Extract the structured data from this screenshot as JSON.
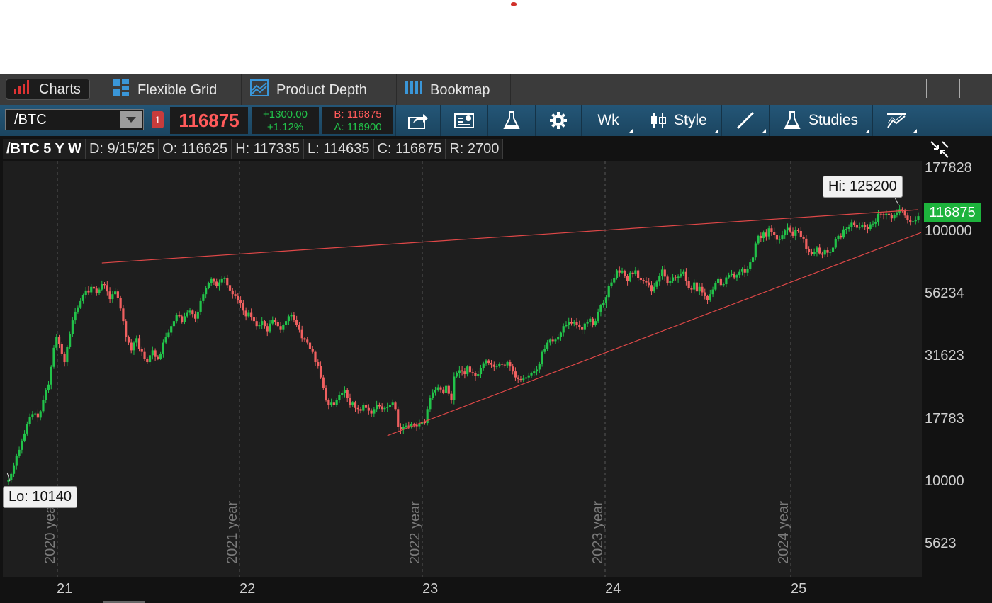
{
  "tabs": [
    {
      "label": "Charts",
      "icon": "bar-chart-icon",
      "active": true
    },
    {
      "label": "Flexible Grid",
      "icon": "grid-icon"
    },
    {
      "label": "Product Depth",
      "icon": "depth-icon"
    },
    {
      "label": "Bookmap",
      "icon": "bookmap-icon"
    }
  ],
  "toolbar": {
    "symbol": "/BTC",
    "badge": "1",
    "last": "116875",
    "change": "+1300.00",
    "change_pct": "+1.12%",
    "bid": "B: 116875",
    "ask": "A: 116900",
    "aggregation": "Wk",
    "style_label": "Style",
    "studies_label": "Studies"
  },
  "infobar": {
    "symbol": "/BTC 5 Y W",
    "date": "D: 9/15/25",
    "open": "O: 116625",
    "high": "H: 117335",
    "low": "L: 114635",
    "close": "C: 116875",
    "range": "R: 2700"
  },
  "colors": {
    "up": "#22c34a",
    "down": "#f06060",
    "trend": "#e04848"
  },
  "chart_data": {
    "type": "candlestick",
    "scale": "log",
    "ylim": [
      4000,
      250000
    ],
    "yticks": [
      "177828",
      "100000",
      "56234",
      "31623",
      "17783",
      "10000",
      "5623"
    ],
    "xticks": [
      "21",
      "22",
      "23",
      "24",
      "25"
    ],
    "year_labels": [
      "2020 year",
      "2021 year",
      "2022 year",
      "2023 year",
      "2024 year"
    ],
    "last_price": "116875",
    "hi_label": "Hi: 125200",
    "lo_label": "Lo: 10140",
    "closes": [
      10300,
      10900,
      11800,
      12900,
      13600,
      14800,
      15800,
      17200,
      18400,
      18900,
      19000,
      18300,
      19400,
      21500,
      23500,
      24800,
      29200,
      34800,
      38500,
      36000,
      33000,
      30500,
      35000,
      39500,
      44800,
      48500,
      50500,
      53500,
      56500,
      59000,
      58000,
      61000,
      60000,
      57500,
      59500,
      62500,
      62000,
      58500,
      54500,
      57000,
      58500,
      55000,
      50000,
      44500,
      38500,
      36500,
      34000,
      36500,
      38000,
      34500,
      33500,
      31500,
      30500,
      32500,
      34000,
      32000,
      31500,
      33000,
      36500,
      38500,
      40000,
      42500,
      44500,
      47000,
      46500,
      44000,
      46500,
      48000,
      49000,
      47500,
      45500,
      48500,
      53500,
      57000,
      60500,
      63000,
      65500,
      64000,
      61500,
      63500,
      65500,
      66000,
      62000,
      59000,
      57000,
      56000,
      54000,
      52500,
      49000,
      46500,
      48000,
      46000,
      44500,
      42500,
      42800,
      44500,
      42500,
      40500,
      43500,
      45000,
      44000,
      42500,
      41000,
      43000,
      44500,
      46500,
      47000,
      45000,
      43000,
      41000,
      38000,
      37500,
      36500,
      34500,
      33500,
      30500,
      29500,
      26500,
      24000,
      21500,
      20500,
      21000,
      20500,
      21500,
      22500,
      23000,
      23500,
      22000,
      20500,
      21000,
      20000,
      19800,
      19500,
      20500,
      20000,
      19500,
      19000,
      19800,
      20500,
      20300,
      19800,
      20000,
      20200,
      20600,
      21000,
      19800,
      16800,
      16400,
      16800,
      17000,
      16900,
      17200,
      17100,
      16900,
      17300,
      17600,
      17400,
      19800,
      22000,
      23100,
      23600,
      24200,
      23700,
      23000,
      24500,
      22800,
      21500,
      26700,
      27500,
      28300,
      28000,
      27300,
      29300,
      27800,
      27500,
      26800,
      27300,
      28800,
      30200,
      31000,
      30300,
      29800,
      29200,
      29500,
      30000,
      29800,
      29600,
      30500,
      29300,
      28000,
      26500,
      26100,
      25900,
      26200,
      26500,
      27000,
      27500,
      28000,
      28500,
      30000,
      33500,
      34500,
      36500,
      37500,
      37000,
      37500,
      38500,
      40000,
      42500,
      43000,
      44000,
      43500,
      44000,
      43000,
      42000,
      41000,
      43500,
      44000,
      45500,
      43000,
      44500,
      48500,
      51500,
      52500,
      55500,
      61500,
      63500,
      66000,
      71000,
      69500,
      70500,
      67500,
      64500,
      69500,
      68500,
      71000,
      66000,
      65000,
      64500,
      63500,
      62000,
      58500,
      61000,
      64000,
      67500,
      71500,
      67000,
      63000,
      64500,
      66500,
      66000,
      67000,
      69000,
      70000,
      64500,
      60500,
      59500,
      63500,
      58500,
      61000,
      58000,
      56000,
      54000,
      57000,
      59500,
      63000,
      65500,
      62000,
      62500,
      66500,
      68000,
      69000,
      66500,
      68000,
      70000,
      72000,
      69500,
      72000,
      76500,
      80000,
      91000,
      97500,
      95500,
      100500,
      97000,
      104500,
      101000,
      98500,
      94000,
      94500,
      98000,
      102500,
      105000,
      101500,
      97500,
      103000,
      102000,
      96500,
      95000,
      86500,
      84000,
      82500,
      84000,
      87500,
      83000,
      82000,
      85500,
      83500,
      84000,
      87500,
      94500,
      97500,
      96000,
      103500,
      104000,
      106000,
      110000,
      107500,
      105000,
      106000,
      107500,
      106000,
      104000,
      108500,
      109000,
      110500,
      119500,
      119000,
      118500,
      119500,
      118000,
      114500,
      118500,
      121000,
      124500,
      123000,
      117500,
      113000,
      111000,
      111500,
      112500,
      116875
    ]
  }
}
